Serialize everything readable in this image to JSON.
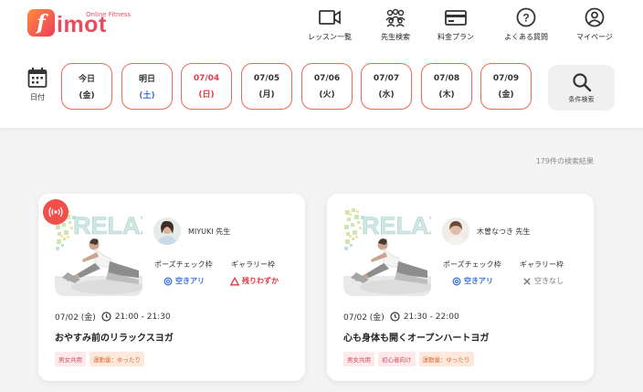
{
  "logo": {
    "mark": "f",
    "word": "imot",
    "sub": "Online Fitness"
  },
  "nav": [
    {
      "label": "レッスン一覧",
      "icon": "video-camera-icon"
    },
    {
      "label": "先生検索",
      "icon": "teachers-icon"
    },
    {
      "label": "料金プラン",
      "icon": "credit-card-icon"
    },
    {
      "label": "よくある質問",
      "icon": "question-circle-icon"
    },
    {
      "label": "マイページ",
      "icon": "user-circle-icon"
    }
  ],
  "calendar_label": "日付",
  "days": [
    {
      "date": "今日",
      "weekday": "(金)"
    },
    {
      "date": "明日",
      "weekday": "(土)"
    },
    {
      "date": "07/04",
      "weekday": "(日)"
    },
    {
      "date": "07/05",
      "weekday": "(月)"
    },
    {
      "date": "07/06",
      "weekday": "(火)"
    },
    {
      "date": "07/07",
      "weekday": "(水)"
    },
    {
      "date": "07/08",
      "weekday": "(木)"
    },
    {
      "date": "07/09",
      "weekday": "(金)"
    }
  ],
  "search_label": "条件検索",
  "results_count": "179件の検索結果",
  "thumb_text": "RELAX",
  "pose_label": "ポーズチェック枠",
  "gallery_label": "ギャラリー枠",
  "cards": [
    {
      "teacher": "MIYUKI 先生",
      "pose_status": "空きアリ",
      "gallery_status": "残りわずか",
      "date": "07/02 (金)",
      "time": "21:00 - 21:30",
      "title": "おやすみ前のリラックスヨガ",
      "tags": [
        "男女共用",
        "運動量：ゆったり"
      ]
    },
    {
      "teacher": "木曽なつき 先生",
      "pose_status": "空きアリ",
      "gallery_status": "空きなし",
      "date": "07/02 (金)",
      "time": "21:30 - 22:00",
      "title": "心も身体も開くオープンハートヨガ",
      "tags": [
        "男女共用",
        "初心者向け",
        "運動量：ゆったり"
      ]
    }
  ],
  "colors": {
    "brand": "#ec4a5c",
    "accent": "#ee6a55",
    "blue": "#3d6fd0",
    "red": "#e0373f"
  }
}
